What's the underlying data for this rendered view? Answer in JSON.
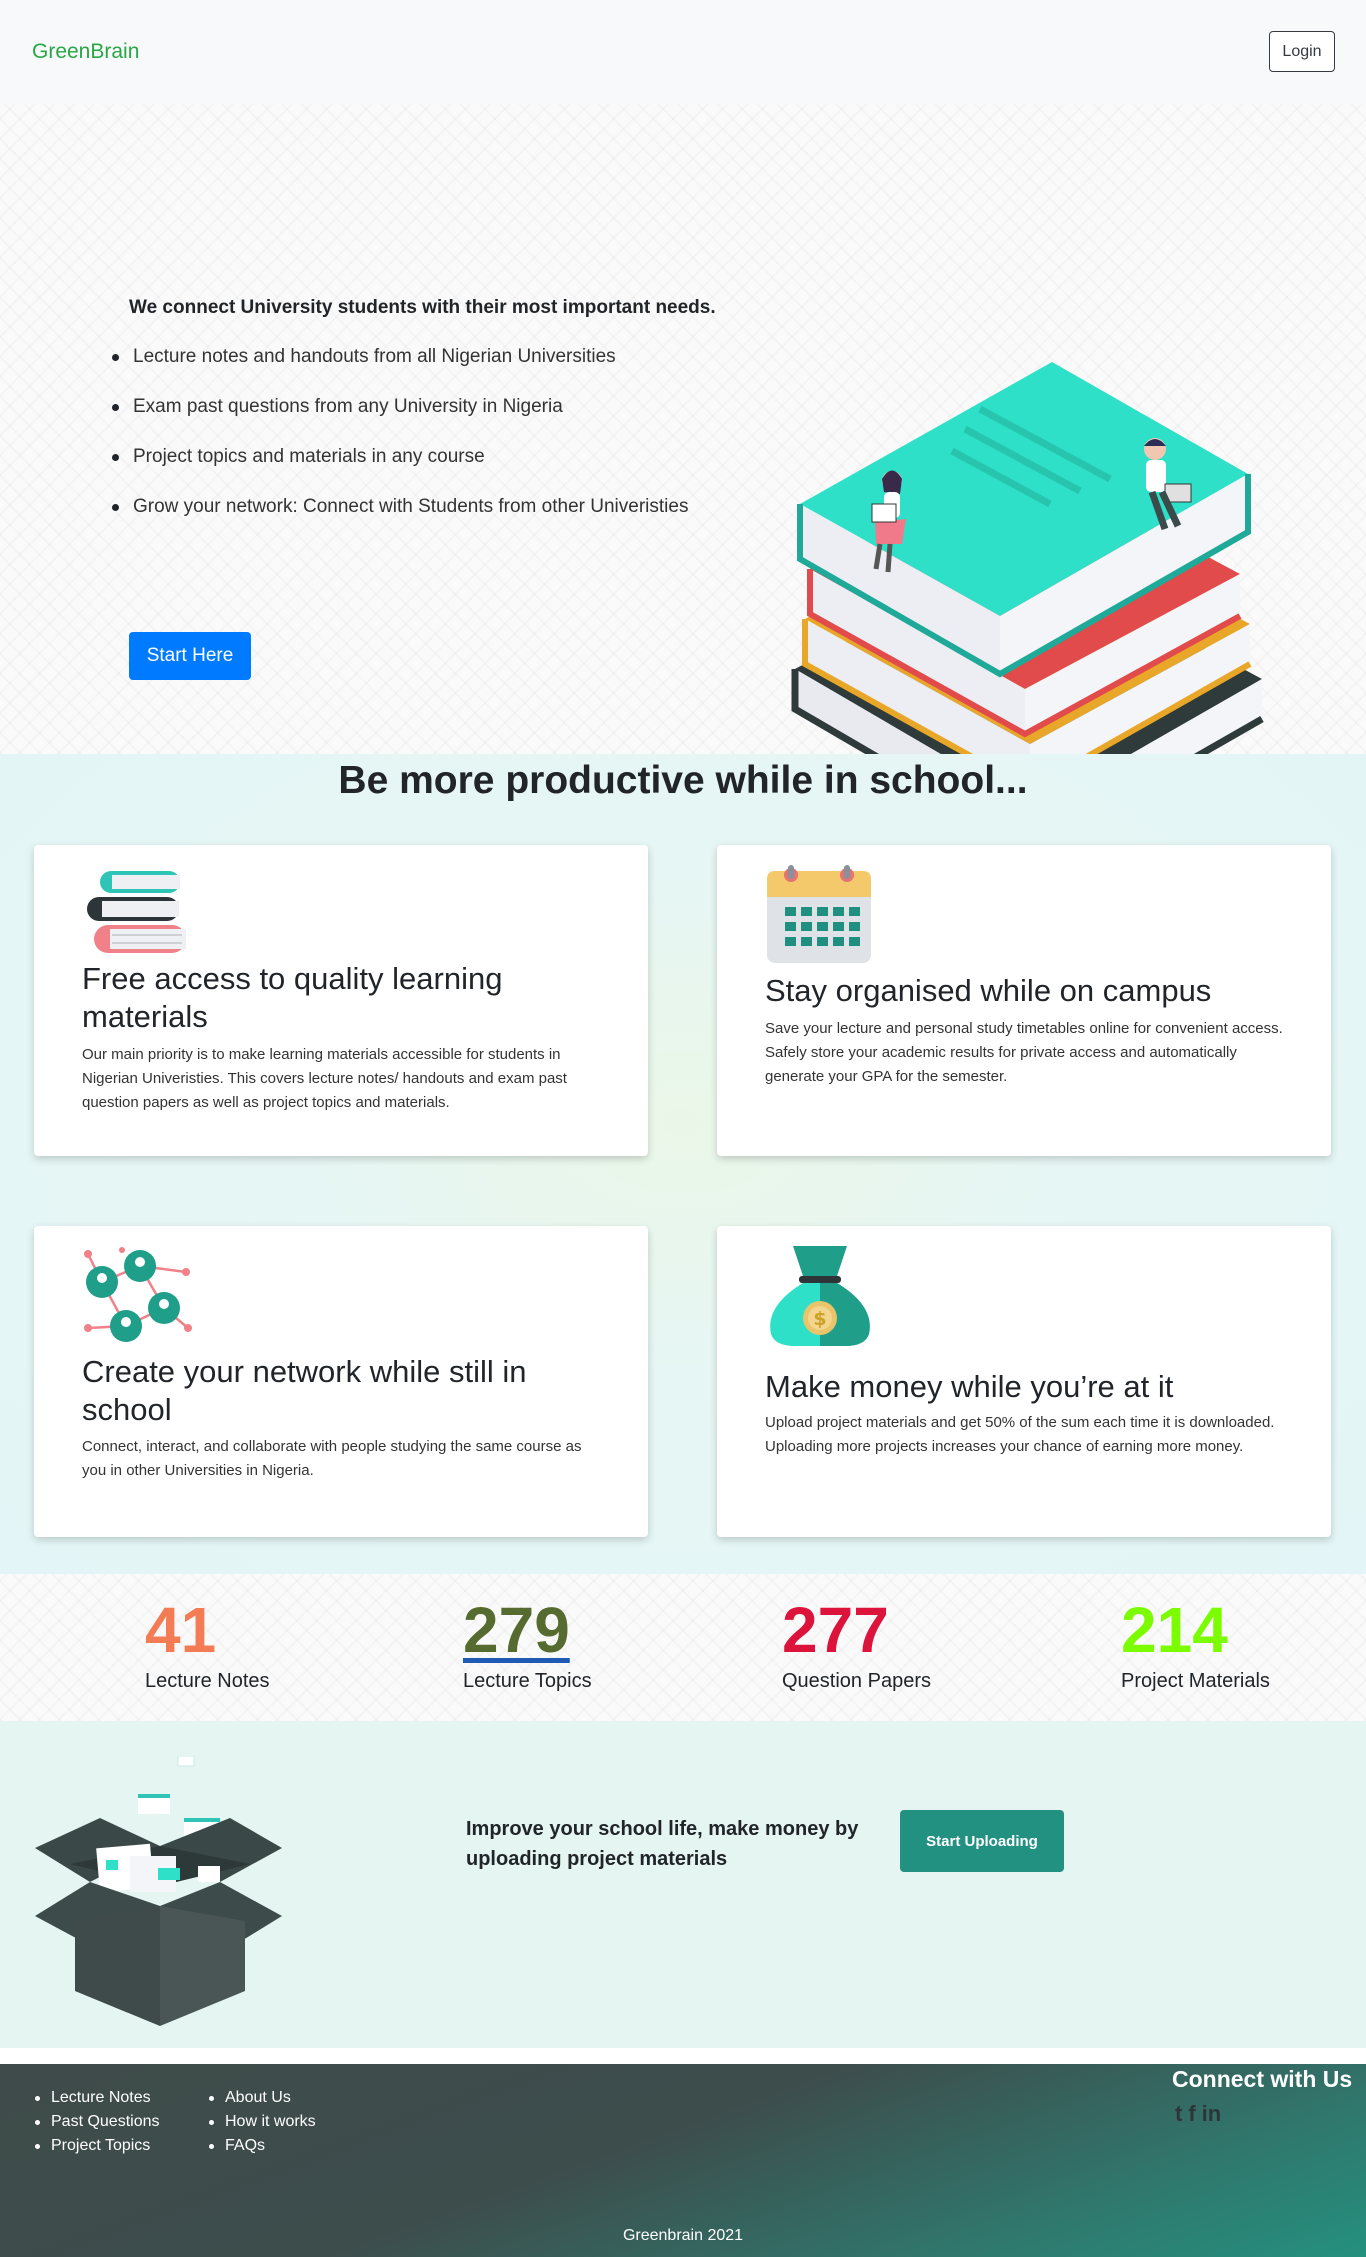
{
  "nav": {
    "brand": "GreenBrain",
    "login_label": "Login"
  },
  "hero": {
    "heading": "We connect University students with their most important needs.",
    "items": [
      "Lecture notes and handouts from all Nigerian Universities",
      "Exam past questions from any University in Nigeria",
      "Project topics and materials in any course",
      "Grow your network: Connect with Students from other Univeristies"
    ],
    "cta_label": "Start Here"
  },
  "productive": {
    "title": "Be more productive while in school...",
    "cards": [
      {
        "icon": "books-stack-icon",
        "title": "Free access to quality learning materials",
        "text": "Our main priority is to make learning materials accessible for students in Nigerian Univeristies. This covers lecture notes/ handouts and exam past question papers as well as project topics and materials."
      },
      {
        "icon": "calendar-icon",
        "title": "Stay organised while on campus",
        "text": "Save your lecture and personal study timetables online for convenient access. Safely store your academic results for private access and automatically generate your GPA for the semester."
      },
      {
        "icon": "network-icon",
        "title": "Create your network while still in school",
        "text": "Connect, interact, and collaborate with people studying the same course as you in other Universities in Nigeria."
      },
      {
        "icon": "money-bag-icon",
        "title": "Make money while you’re at it",
        "text": "Upload project materials and get 50% of the sum each time it is downloaded. Uploading more projects increases your chance of earning more money."
      }
    ]
  },
  "stats": [
    {
      "value": "41",
      "label": "Lecture Notes",
      "color": "#f47c55"
    },
    {
      "value": "279",
      "label": "Lecture Topics",
      "color": "#556b2f"
    },
    {
      "value": "277",
      "label": "Question Papers",
      "color": "#dc143c"
    },
    {
      "value": "214",
      "label": "Project Materials",
      "color": "#7cfc00"
    }
  ],
  "upload": {
    "text": "Improve your school life, make money by uploading project materials",
    "button_label": "Start Uploading"
  },
  "footer": {
    "col1": [
      "Lecture Notes",
      "Past Questions",
      "Project Topics"
    ],
    "col2": [
      "About Us",
      "How it works",
      "FAQs"
    ],
    "connect_title": "Connect with Us",
    "social": [
      "twitter-icon",
      "facebook-icon",
      "linkedin-icon"
    ],
    "copyright": "Greenbrain 2021"
  }
}
